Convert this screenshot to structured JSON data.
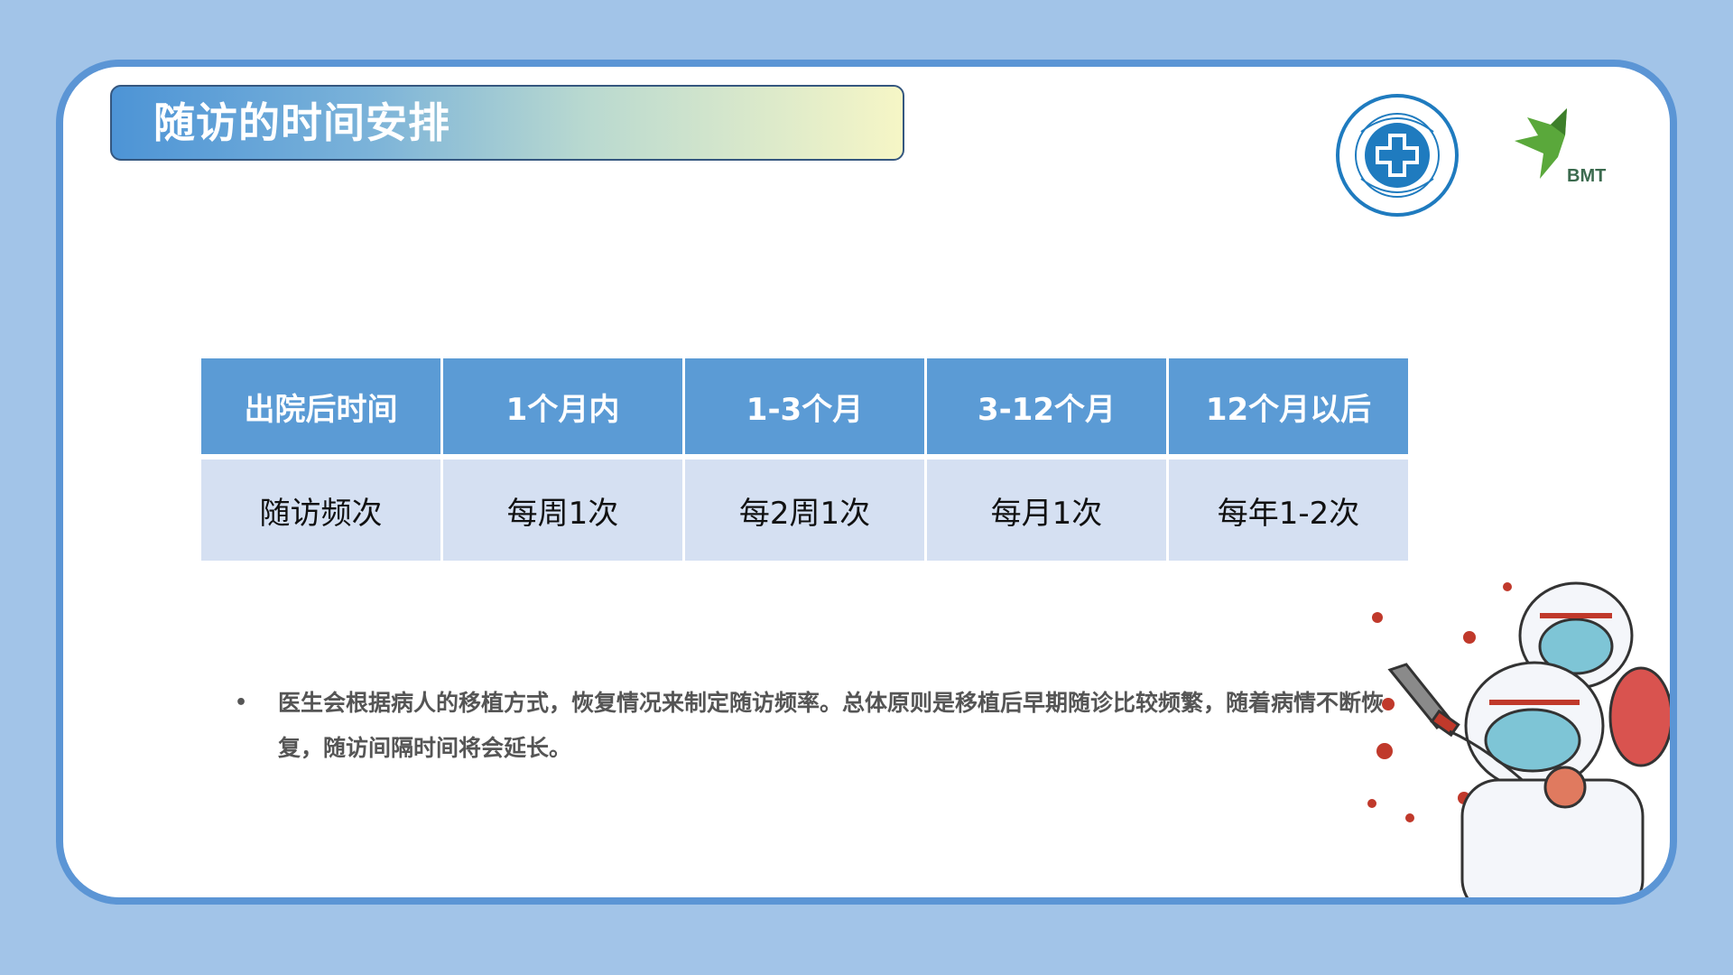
{
  "title": "随访的时间安排",
  "logos": {
    "bmt_label": "BMT"
  },
  "table": {
    "headers": [
      "出院后时间",
      "1个月内",
      "1-3个月",
      "3-12个月",
      "12个月以后"
    ],
    "row": [
      "随访频次",
      "每周1次",
      "每2周1次",
      "每月1次",
      "每年1-2次"
    ]
  },
  "note": "医生会根据病人的移植方式，恢复情况来制定随访频率。总体原则是移植后早期随诊比较频繁，随着病情不断恢复，随访间隔时间将会延长。",
  "colors": {
    "frame": "#5b95d5",
    "header": "#5b9bd5",
    "cell": "#d5e0f2",
    "background": "#a2c4e8"
  }
}
